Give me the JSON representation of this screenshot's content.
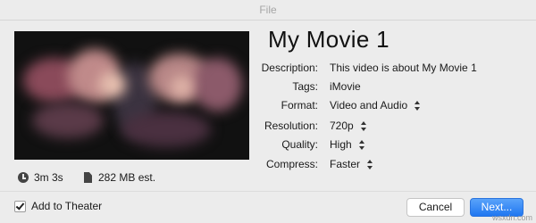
{
  "window": {
    "title": "File"
  },
  "thumbnail": {
    "description_icon": "video-thumbnail"
  },
  "movie": {
    "title": "My Movie 1",
    "duration": "3m 3s",
    "size": "282 MB est."
  },
  "fields": {
    "description": {
      "label": "Description:",
      "value": "This video is about My Movie 1"
    },
    "tags": {
      "label": "Tags:",
      "value": "iMovie"
    },
    "format": {
      "label": "Format:",
      "value": "Video and Audio"
    },
    "resolution": {
      "label": "Resolution:",
      "value": "720p"
    },
    "quality": {
      "label": "Quality:",
      "value": "High"
    },
    "compress": {
      "label": "Compress:",
      "value": "Faster"
    }
  },
  "footer": {
    "checkbox_label": "Add to Theater",
    "checkbox_checked": true,
    "cancel_label": "Cancel",
    "next_label": "Next..."
  },
  "watermark": "wsxdn.com",
  "colors": {
    "accent": "#1f77f1",
    "background": "#ececec"
  }
}
